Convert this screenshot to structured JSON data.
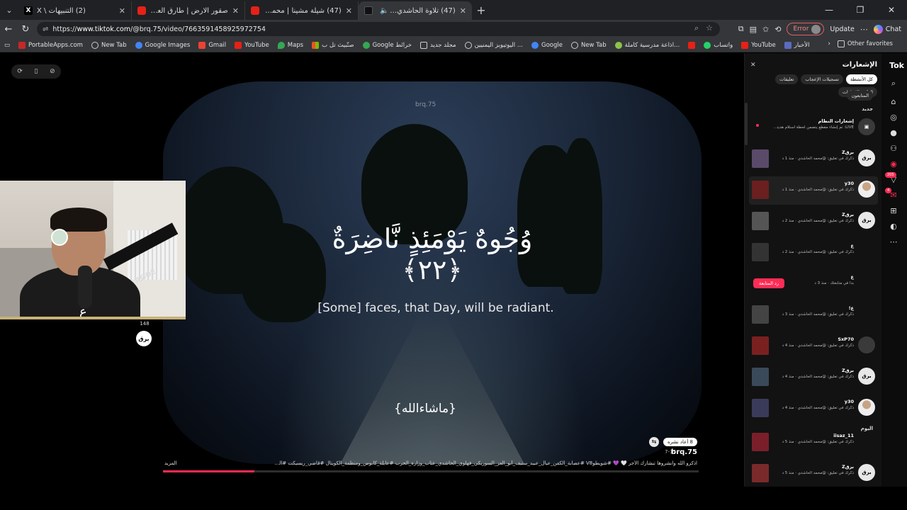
{
  "tabs": [
    {
      "title": "(2) التنبيهات \\ X",
      "icon": "x-logo-icon",
      "active": false
    },
    {
      "title": "صقور الارض | طارق العربي طر",
      "icon": "youtube-icon",
      "active": false
    },
    {
      "title": "(47) شيلة مشينا | محمد الدخيل | موّ",
      "icon": "youtube-icon",
      "active": false
    },
    {
      "title": "(47) تلاوة الحاشدي صدقة جارية لمرحّ",
      "icon": "tiktok-icon",
      "active": true
    }
  ],
  "address": {
    "protocol": "https://",
    "host": "www.tiktok.com",
    "path": "/@brq.75/video/7663591458925972754",
    "error_label": "Error",
    "update_label": "Update",
    "chat_label": "Chat"
  },
  "bookmarks": [
    {
      "label": "PortableApps.com",
      "icon": "portableapps-icon"
    },
    {
      "label": "New Tab",
      "icon": "globe-icon"
    },
    {
      "label": "Google Images",
      "icon": "google-icon"
    },
    {
      "label": "Gmail",
      "icon": "gmail-icon"
    },
    {
      "label": "YouTube",
      "icon": "youtube-icon"
    },
    {
      "label": "Maps",
      "icon": "maps-icon"
    },
    {
      "label": "صنّبيث تل ب",
      "icon": "microsoft-icon"
    },
    {
      "label": "Google خرائط",
      "icon": "maps-icon"
    },
    {
      "label": "مجلد جديد",
      "icon": "folder-icon"
    },
    {
      "label": "اليوتيوبز اليمنيين ...",
      "icon": "openai-icon"
    },
    {
      "label": "Google",
      "icon": "google-icon"
    },
    {
      "label": "New Tab",
      "icon": "globe-icon"
    },
    {
      "label": "اذاعة مدرسية كاملة...",
      "icon": "site-icon"
    },
    {
      "label": "",
      "icon": "youtube-icon"
    },
    {
      "label": "واتساب",
      "icon": "whatsapp-icon"
    },
    {
      "label": "YouTube",
      "icon": "youtube-icon"
    },
    {
      "label": "الأخبار",
      "icon": "news-icon"
    }
  ],
  "bookmarks_other": "Other favorites",
  "video": {
    "watermark": "brq.75",
    "ayah": "وُجُوهٌ يَوْمَئِذٍ نَّاضِرَةٌ ﴿٢٢﴾",
    "translation": "[Some] faces, that Day, will be radiant.",
    "overlay_text": "{ماشاءالله}",
    "progress": 0.17
  },
  "creator": {
    "like_count": "148",
    "avatar_text": "برق"
  },
  "meta": {
    "repost_label": "8 أعاد نشره",
    "author": "brq.75",
    "date": "7-17",
    "caption": "اذكرو الله وانشروها تنشارك الأجر 🤍 💜 #شويطوV8 #عصابة_الكفن_عيال_عبيد_ستيف_أبو_العز_السوريكي_فهلوي_الحاشدي_عتاب_وزارة_الحرب #عايلة_كابوس_ومنظمة_الكويتال #قاضي_ريسيكت #الحاشدي...",
    "more_label": "المزيد"
  },
  "notifications": {
    "title": "الإشعارات",
    "filters": [
      "كل الأنشطة",
      "تسجيلات الإعجاب",
      "تعليقات",
      "الذكر والإشارات"
    ],
    "filter_row2": "المتابعون",
    "section_new": "جديد",
    "section_today": "اليوم",
    "items": [
      {
        "user": "إشعارات النظام",
        "desc": "LIVE: تم إنشاء مقطع يتضمن لحظة استلام هديتك المذهله.",
        "avatar": "system",
        "thumb": false,
        "dot": true
      },
      {
        "user": "برقZ",
        "desc": "ذكرك في تعليق: @محمد الحاشدي · منذ 1 د",
        "avatar": "brq",
        "thumb": true
      },
      {
        "user": "y30",
        "desc": "ذكرك في تعليق: @محمد الحاشدي · منذ 1 د",
        "avatar": "person",
        "thumb": true,
        "hover": true
      },
      {
        "user": "برقZ",
        "desc": "ذكرك في تعليق: @محمد الحاشدي · منذ 2 د",
        "avatar": "brq",
        "thumb": true
      },
      {
        "user": "ع",
        "desc": "ذكرك في تعليق: @محمد الحاشدي · منذ 2 د",
        "avatar": "scene",
        "thumb": true
      },
      {
        "user": "ع",
        "desc": "بدأ في متابعتك · منذ 3 د",
        "avatar": "scene",
        "thumb": false,
        "follow_back": "رد المتابعة"
      },
      {
        "user": "ع!",
        "desc": "ذكرك في تعليق: @محمد الحاشدي · منذ 3 د",
        "avatar": "none",
        "thumb": true
      },
      {
        "user": "SxP70",
        "desc": "ذكرك في تعليق: @محمد الحاشدي · منذ 4 د",
        "avatar": "dark",
        "thumb": true
      },
      {
        "user": "برقZ",
        "desc": "ذكرك في تعليق: @محمد الحاشدي · منذ 4 د",
        "avatar": "brq",
        "thumb": true
      },
      {
        "user": "y30",
        "desc": "ذكرك في تعليق: @محمد الحاشدي · منذ 4 د",
        "avatar": "person",
        "thumb": true
      },
      {
        "user": "iisaz_11",
        "desc": "ذكرك في تعليق: @محمد الحاشدي · منذ 5 د",
        "avatar": "none",
        "thumb": true
      },
      {
        "user": "برقZ",
        "desc": "ذكرك في تعليق: @محمد الحاشدي · منذ 5 د",
        "avatar": "brq",
        "thumb": true
      }
    ]
  },
  "rail": {
    "logo": "TikTok",
    "badge_messages": "205",
    "badge_inbox": "4"
  },
  "colors": {
    "accent": "#fe2c55",
    "panel_bg": "#121212",
    "chrome_bg": "#35363a"
  }
}
